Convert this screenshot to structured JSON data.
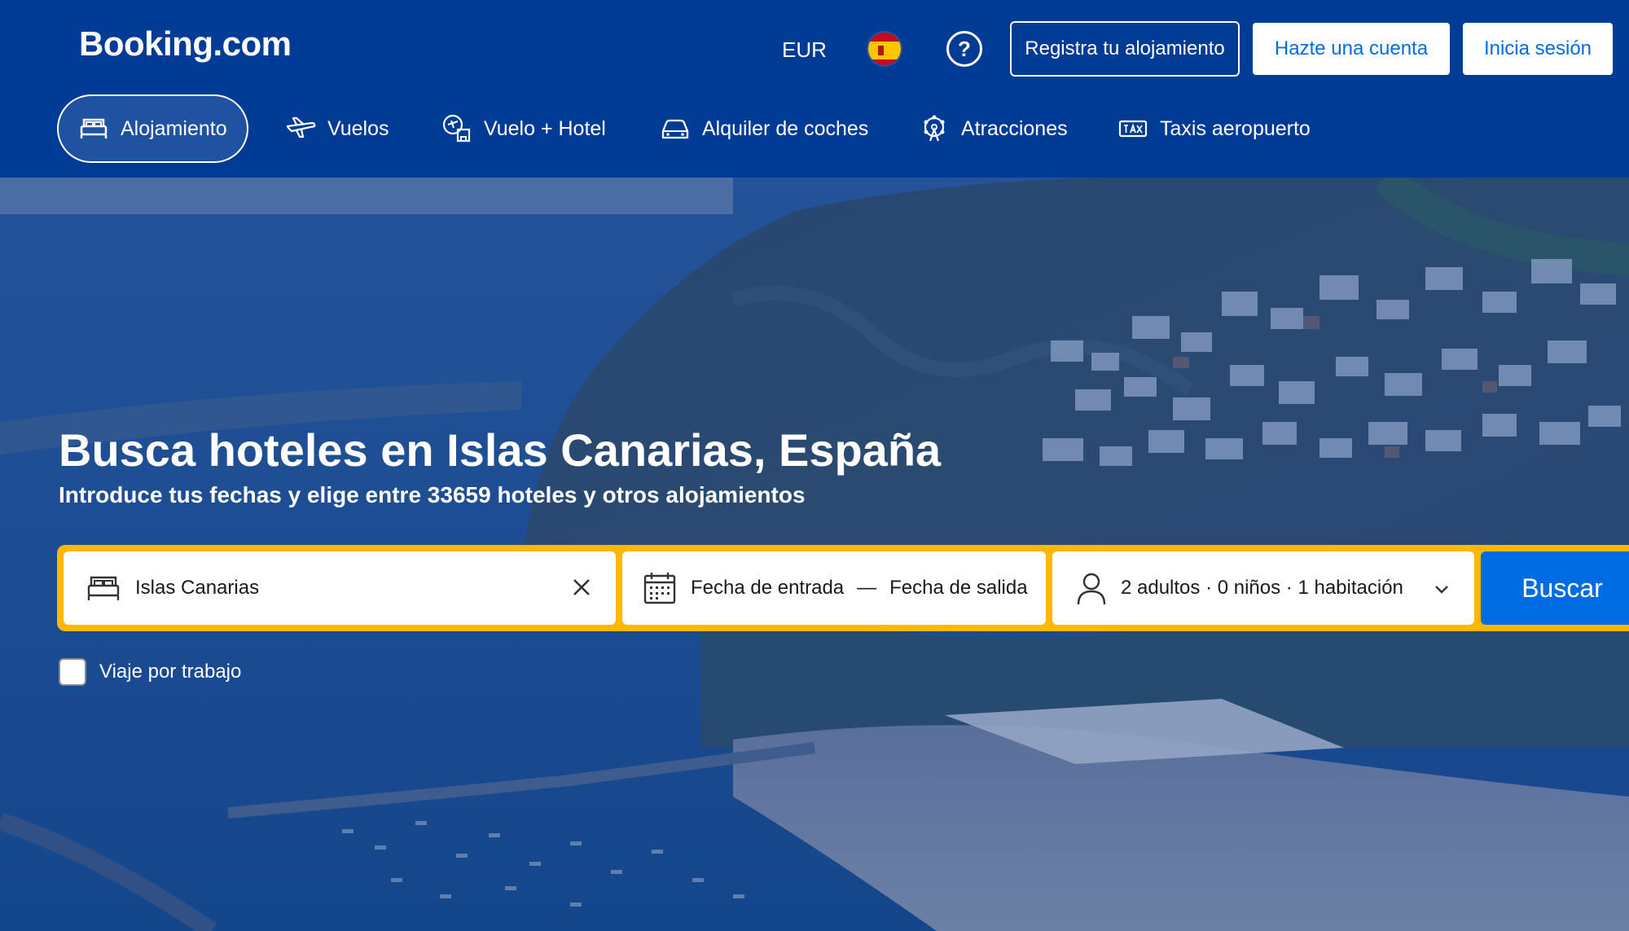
{
  "brand": {
    "logo_text": "Booking.com"
  },
  "header": {
    "currency": "EUR",
    "help_label": "?",
    "list_property": "Registra tu alojamiento",
    "register": "Hazte una cuenta",
    "sign_in": "Inicia sesión"
  },
  "nav": {
    "items": [
      {
        "label": "Alojamiento",
        "icon": "bed-icon",
        "active": true
      },
      {
        "label": "Vuelos",
        "icon": "plane-icon"
      },
      {
        "label": "Vuelo + Hotel",
        "icon": "flight-hotel-icon"
      },
      {
        "label": "Alquiler de coches",
        "icon": "car-icon"
      },
      {
        "label": "Atracciones",
        "icon": "attractions-icon"
      },
      {
        "label": "Taxis aeropuerto",
        "icon": "taxi-icon"
      }
    ]
  },
  "hero": {
    "title": "Busca hoteles en Islas Canarias, España",
    "subtitle": "Introduce tus fechas y elige entre 33659 hoteles y otros alojamientos"
  },
  "search": {
    "destination_value": "Islas Canarias",
    "checkin_placeholder": "Fecha de entrada",
    "date_separator": "—",
    "checkout_placeholder": "Fecha de salida",
    "guests_value": "2 adultos · 0 niños · 1 habitación",
    "button_label": "Buscar"
  },
  "business_trip": {
    "label": "Viaje por trabajo",
    "checked": false
  },
  "colors": {
    "brand_blue": "#003b95",
    "search_yellow": "#ffb700",
    "action_blue": "#006ce4"
  }
}
